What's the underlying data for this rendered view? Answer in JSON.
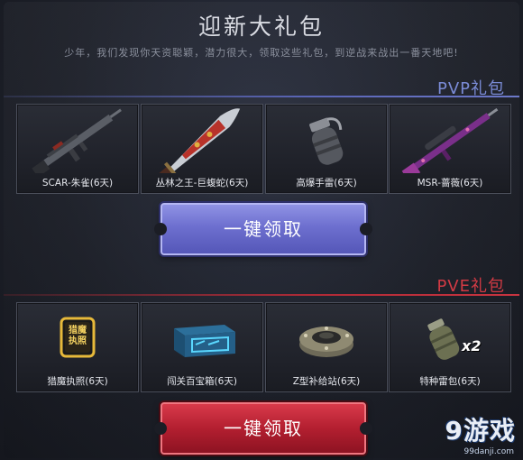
{
  "header": {
    "title": "迎新大礼包",
    "subtitle": "少年，我们发现你天资聪颖，潜力很大，领取这些礼包，到逆战来战出一番天地吧!"
  },
  "pvp": {
    "label": "PVP礼包",
    "items": [
      {
        "name": "SCAR-朱雀(6天)",
        "icon": "assault-rifle-icon"
      },
      {
        "name": "丛林之王-巨蝮蛇(6天)",
        "icon": "machete-icon"
      },
      {
        "name": "高爆手雷(6天)",
        "icon": "grenade-icon"
      },
      {
        "name": "MSR-蔷薇(6天)",
        "icon": "sniper-rifle-icon"
      }
    ],
    "button": "一键领取"
  },
  "pve": {
    "label": "PVE礼包",
    "items": [
      {
        "name": "猎魔执照(6天)",
        "icon": "license-badge-icon",
        "badge_text": "猎魔执照"
      },
      {
        "name": "闯关百宝箱(6天)",
        "icon": "treasure-box-icon"
      },
      {
        "name": "Z型补给站(6天)",
        "icon": "supply-station-icon"
      },
      {
        "name": "特种雷包(6天)",
        "icon": "mine-pack-icon",
        "badge_text": "x2"
      }
    ],
    "button": "一键领取"
  },
  "watermark": {
    "brand": "9游戏",
    "url": "99danji.com"
  },
  "colors": {
    "pvp_accent": "#7a8bd6",
    "pve_accent": "#d13a44",
    "button_blue": "#6d6fcf",
    "button_red": "#b31f30"
  }
}
